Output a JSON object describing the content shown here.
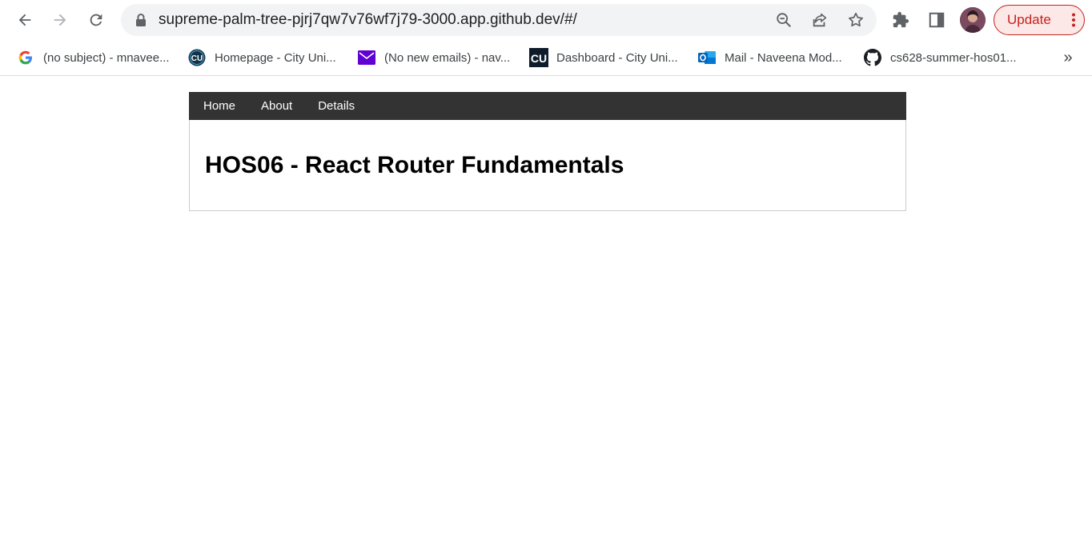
{
  "browser": {
    "url": "supreme-palm-tree-pjrj7qw7v76wf7j79-3000.app.github.dev/#/",
    "update_label": "Update",
    "icons": {
      "back": "back-arrow-icon",
      "forward": "forward-arrow-icon",
      "reload": "reload-icon",
      "lock": "lock-icon",
      "zoom": "zoom-out-icon",
      "share": "share-icon",
      "bookmark": "star-icon",
      "extensions": "puzzle-icon",
      "side_panel": "side-panel-icon",
      "menu": "kebab-menu-icon"
    }
  },
  "bookmarks": [
    {
      "label": "(no subject) - mnavee...",
      "icon": "google-icon"
    },
    {
      "label": "Homepage - City Uni...",
      "icon": "cu-circle-icon"
    },
    {
      "label": "(No new emails) - nav...",
      "icon": "mail-icon"
    },
    {
      "label": "Dashboard - City Uni...",
      "icon": "cu-square-icon"
    },
    {
      "label": "Mail - Naveena Mod...",
      "icon": "outlook-icon"
    },
    {
      "label": "cs628-summer-hos01...",
      "icon": "github-icon"
    }
  ],
  "bookmarks_more": "»",
  "app": {
    "nav": [
      "Home",
      "About",
      "Details"
    ],
    "title": "HOS06 - React Router Fundamentals"
  },
  "colors": {
    "nav_bg": "#333333",
    "update_accent": "#c5221f",
    "omnibox_bg": "#f1f3f4"
  }
}
